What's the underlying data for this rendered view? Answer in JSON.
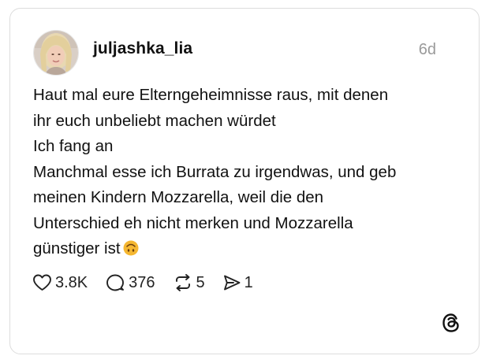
{
  "post": {
    "username": "juljashka_lia",
    "time_ago": "6d",
    "body_lines": [
      "Haut mal eure Elterngeheimnisse raus, mit denen",
      "ihr euch unbeliebt machen würdet",
      "Ich fang an",
      "Manchmal esse ich Burrata zu irgendwas, und geb",
      "meinen Kindern Mozzarella, weil die den",
      "Unterschied eh nicht merken und Mozzarella",
      "günstiger ist"
    ],
    "emoji": "upside-down-face-emoji"
  },
  "actions": {
    "likes": "3.8K",
    "replies": "376",
    "reposts": "5",
    "shares": "1"
  },
  "icons": {
    "like": "heart-icon",
    "reply": "comment-icon",
    "repost": "repost-icon",
    "share": "share-icon",
    "brand": "threads-logo-icon"
  },
  "colors": {
    "border": "#dcdcdc",
    "timestamp": "#9a9a9a",
    "text": "#111111",
    "emoji": "#f5b731"
  }
}
